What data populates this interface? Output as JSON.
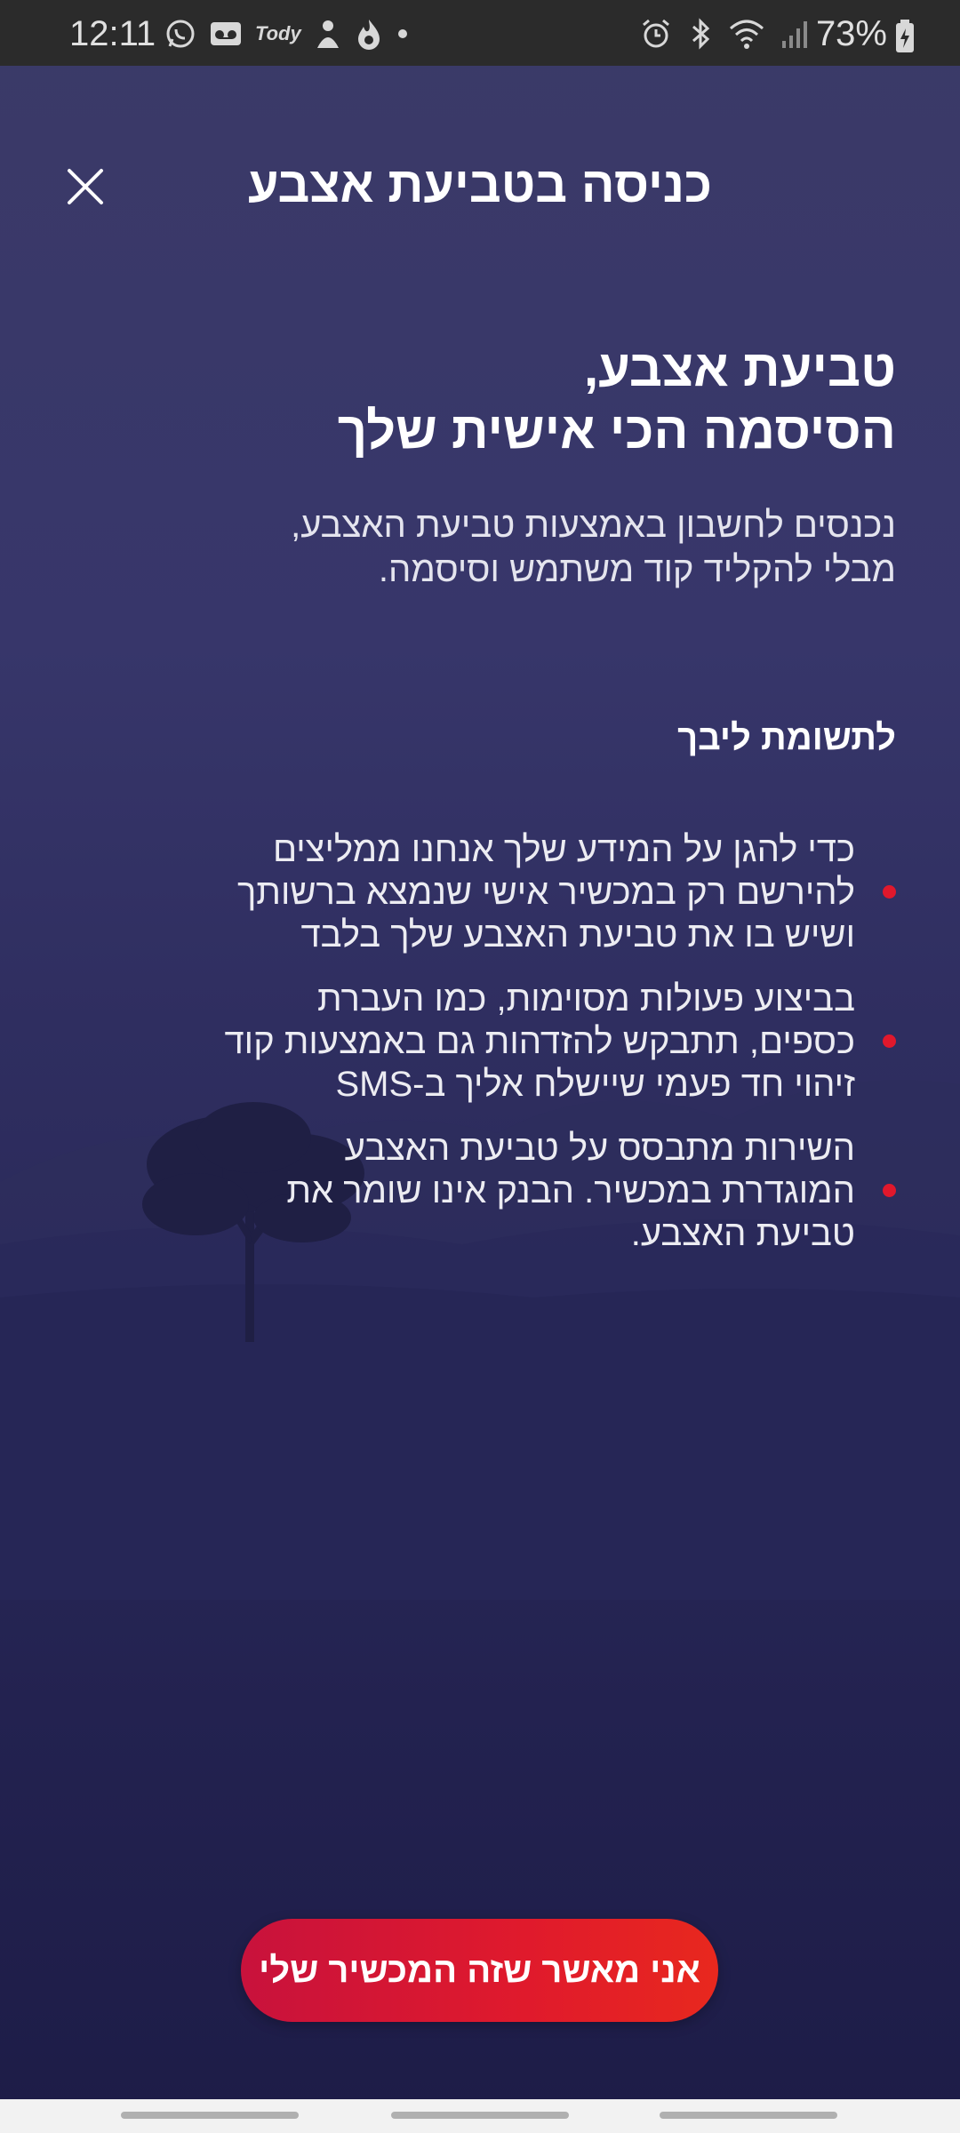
{
  "status_bar": {
    "time": "12:11",
    "battery": "73%",
    "left_icons": [
      "whatsapp-icon",
      "voicemail-icon",
      "tody-icon",
      "emoji-icon",
      "flame-icon",
      "dot-icon"
    ],
    "left_icon_text": "Tody",
    "right_icons": [
      "alarm-icon",
      "bluetooth-icon",
      "wifi-icon",
      "signal-icon",
      "battery-icon"
    ]
  },
  "header": {
    "title": "כניסה בטביעת אצבע",
    "close_icon": "close-icon"
  },
  "headline": {
    "line1": "טביעת אצבע,",
    "line2": "הסיסמה הכי אישית שלך"
  },
  "subtext": {
    "line1": "נכנסים לחשבון באמצעות טביעת האצבע,",
    "line2": "מבלי להקליד קוד משתמש וסיסמה."
  },
  "attention": {
    "title": "לתשומת ליבך"
  },
  "bullets": [
    {
      "lines": [
        "כדי להגן על המידע שלך אנחנו ממליצים",
        "להירשם רק במכשיר אישי שנמצא ברשותך",
        "ושיש בו את טביעת האצבע שלך בלבד"
      ]
    },
    {
      "lines": [
        "בביצוע פעולות מסוימות, כמו העברת",
        "כספים, תתבקש להזדהות גם באמצעות קוד",
        "זיהוי חד פעמי שיישלח אליך ב-SMS"
      ]
    },
    {
      "lines": [
        "השירות מתבסס על טביעת האצבע",
        "המוגדרת במכשיר. הבנק אינו שומר את",
        "טביעת האצבע."
      ]
    }
  ],
  "cta": {
    "label": "אני מאשר שזה המכשיר שלי"
  },
  "colors": {
    "background_top": "#3b3a68",
    "background_bottom": "#1d1c47",
    "accent_red": "#e0182c",
    "text": "#ffffff"
  }
}
